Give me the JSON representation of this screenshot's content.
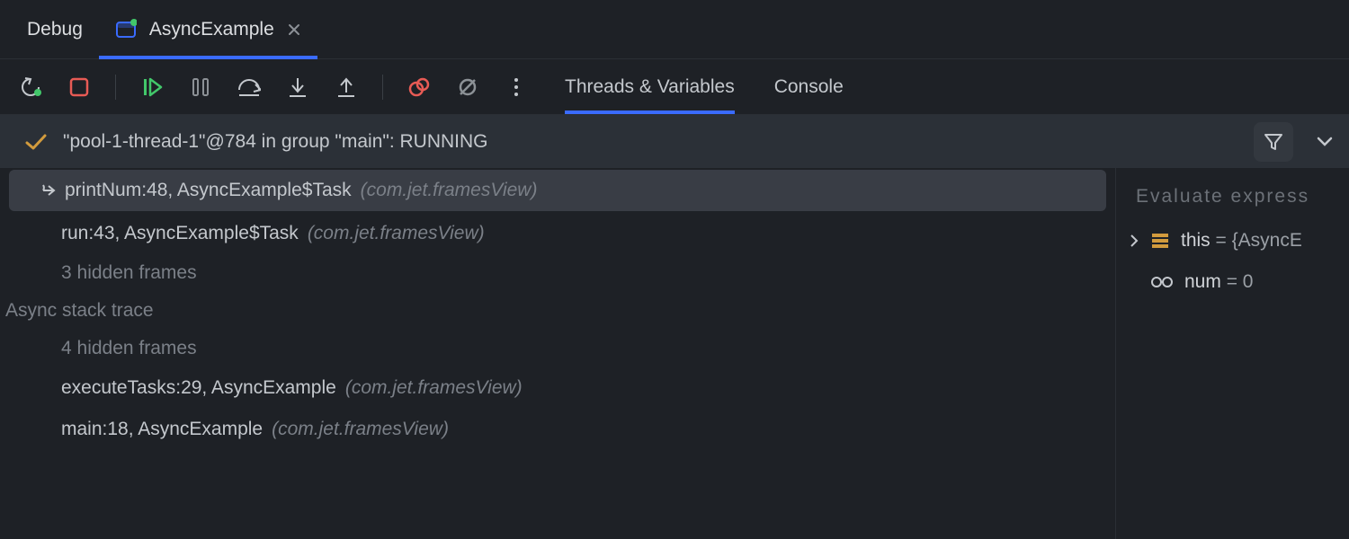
{
  "header": {
    "tool_window_title": "Debug",
    "run_tab_name": "AsyncExample"
  },
  "toolbar": {
    "tabs": {
      "threads_vars": "Threads & Variables",
      "console": "Console",
      "active": "threads_vars"
    }
  },
  "thread": {
    "label": "\"pool-1-thread-1\"@784 in group \"main\": RUNNING"
  },
  "frames": {
    "items": [
      {
        "selected": true,
        "method": "printNum:48, AsyncExample$Task",
        "pkg": "(com.jet.framesView)"
      },
      {
        "selected": false,
        "method": "run:43, AsyncExample$Task",
        "pkg": "(com.jet.framesView)"
      }
    ],
    "hidden_top": "3 hidden frames",
    "async_label": "Async stack trace",
    "hidden_async": "4 hidden frames",
    "async_items": [
      {
        "method": "executeTasks:29, AsyncExample",
        "pkg": "(com.jet.framesView)"
      },
      {
        "method": "main:18, AsyncExample",
        "pkg": "(com.jet.framesView)"
      }
    ]
  },
  "variables": {
    "evaluate_placeholder": "Evaluate express",
    "items": [
      {
        "name": "this",
        "value": "= {AsyncE",
        "icon": "object",
        "expandable": true
      },
      {
        "name": "num",
        "value": "= 0",
        "icon": "glasses",
        "expandable": false
      }
    ]
  },
  "colors": {
    "accent": "#3a6bff",
    "stop": "#e85b55",
    "resume": "#42c76a",
    "warn": "#d29b3d",
    "break": "#e85b55",
    "break_mute": "#8c9196"
  }
}
